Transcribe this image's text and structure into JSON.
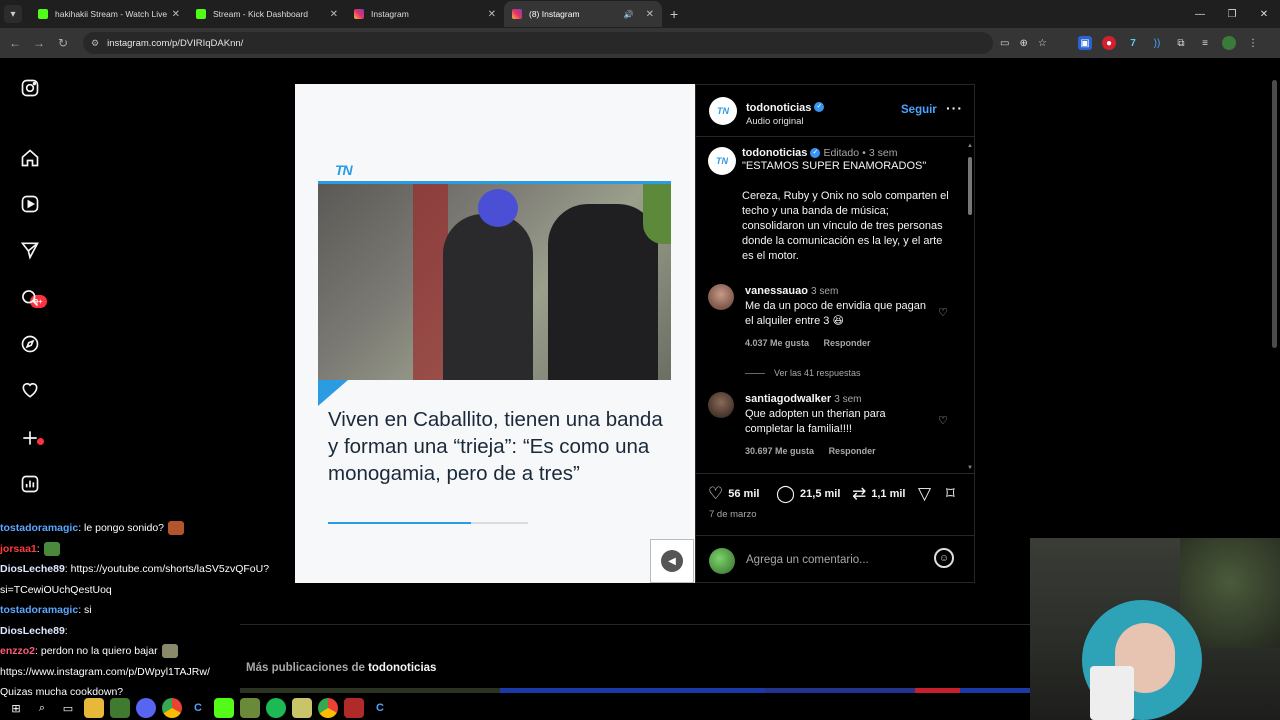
{
  "browser": {
    "tabs": [
      {
        "title": "hakihakii Stream - Watch Live o",
        "favicon": "kick",
        "active": false
      },
      {
        "title": "Stream - Kick Dashboard",
        "favicon": "kick",
        "active": false
      },
      {
        "title": "Instagram",
        "favicon": "instagram",
        "active": false
      },
      {
        "title": "(8) Instagram",
        "favicon": "instagram",
        "active": true
      }
    ],
    "url": "instagram.com/p/DVIRIqDAKnn/"
  },
  "sidebar": {
    "notifications_badge": "9+"
  },
  "post": {
    "media": {
      "logo": "TN",
      "headline": "Viven en Caballito, tienen una banda y forman una “trieja”: “Es como una monogamia, pero de a tres”"
    },
    "header": {
      "username": "todonoticias",
      "audio": "Audio original",
      "follow_label": "Seguir"
    },
    "caption": {
      "username": "todonoticias",
      "edited": "Editado",
      "time": "3 sem",
      "paragraphs": [
        "\"ESTAMOS SUPER ENAMORADOS\"",
        "Cereza, Ruby y Onix no solo comparten el techo y una banda de música; consolidaron un vínculo de tres personas donde la comunicación es la ley, y el arte es el motor."
      ]
    },
    "comments": [
      {
        "username": "vanessauao",
        "time": "3 sem",
        "text": "Me da un poco de envidia que pagan el alquiler entre 3 😆",
        "likes": "4.037 Me gusta",
        "reply": "Responder"
      },
      {
        "username": "santiagodwalker",
        "time": "3 sem",
        "text": "Que adopten un therian para completar la familia!!!!",
        "likes": "30.697 Me gusta",
        "reply": "Responder"
      }
    ],
    "view_replies": "Ver las 41 respuestas",
    "actions": {
      "likes": "56 mil",
      "comments": "21,5 mil",
      "reposts": "1,1 mil"
    },
    "date": "7 de marzo",
    "comment_placeholder": "Agrega un comentario...",
    "more_posts_prefix": "Más publicaciones de",
    "more_posts_user": "todonoticias"
  },
  "chat": [
    {
      "user": "tostadoramagic",
      "color": "blue",
      "msg": ": le pongo sonido?"
    },
    {
      "user": "jorsaa1",
      "color": "red",
      "msg": ":"
    },
    {
      "user": "DiosLeche89",
      "color": "white",
      "msg": ": https://youtube.com/shorts/laSV5zvQFoU?"
    },
    {
      "user": "",
      "color": "white",
      "msg": "si=TCewiOUchQestUoq"
    },
    {
      "user": "tostadoramagic",
      "color": "blue",
      "msg": ": si"
    },
    {
      "user": "DiosLeche89",
      "color": "white",
      "msg": ":"
    },
    {
      "user": "enzzo2",
      "color": "pink",
      "msg": ": perdon no la quiero bajar"
    },
    {
      "user": "",
      "color": "white",
      "msg": "https://www.instagram.com/p/DWpyl1TAJRw/"
    },
    {
      "user": "",
      "color": "white",
      "msg": "Quizas mucha cookdown?"
    }
  ]
}
